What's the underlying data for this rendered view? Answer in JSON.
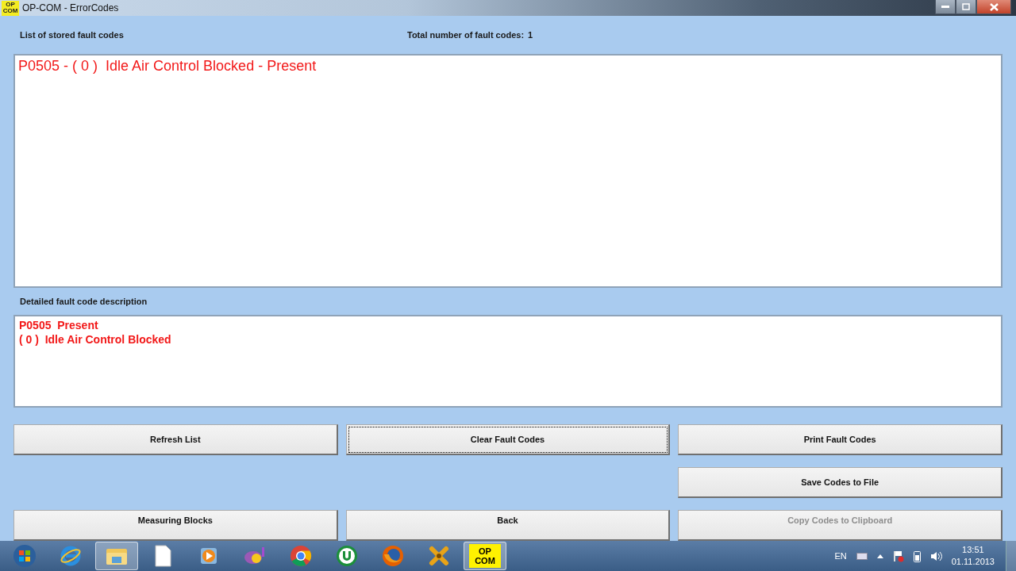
{
  "window": {
    "title": "OP-COM - ErrorCodes",
    "icon_lines": [
      "OP",
      "COM"
    ]
  },
  "list_label": "List of stored fault codes",
  "total_label": "Total number of fault codes:",
  "total_value": "1",
  "fault_list": [
    "P0505 - ( 0 )  Idle Air Control Blocked - Present"
  ],
  "detail_label": "Detailed fault code description",
  "detail_lines": [
    "P0505  Present",
    "( 0 )  Idle Air Control Blocked"
  ],
  "button_rows": [
    [
      {
        "kind": "button",
        "label": "Refresh List",
        "focused": false,
        "disabled": false
      },
      {
        "kind": "button",
        "label": "Clear Fault Codes",
        "focused": true,
        "disabled": false
      },
      {
        "kind": "button",
        "label": "Print Fault Codes",
        "focused": false,
        "disabled": false
      }
    ],
    [
      {
        "kind": "spacer"
      },
      {
        "kind": "spacer"
      },
      {
        "kind": "button",
        "label": "Save Codes to File",
        "focused": false,
        "disabled": false
      }
    ],
    [
      {
        "kind": "button",
        "label": "Measuring Blocks",
        "focused": false,
        "disabled": false
      },
      {
        "kind": "button",
        "label": "Back",
        "focused": false,
        "disabled": false
      },
      {
        "kind": "button",
        "label": "Copy Codes to Clipboard",
        "focused": false,
        "disabled": true
      }
    ]
  ],
  "taskbar": {
    "items": [
      {
        "kind": "start",
        "selected": false
      },
      {
        "kind": "browser-e",
        "selected": false
      },
      {
        "kind": "folder",
        "selected": true
      },
      {
        "kind": "document",
        "selected": false
      },
      {
        "kind": "media",
        "selected": false
      },
      {
        "kind": "messenger",
        "selected": false
      },
      {
        "kind": "chrome",
        "selected": false
      },
      {
        "kind": "torrent",
        "selected": false
      },
      {
        "kind": "firefox",
        "selected": false
      },
      {
        "kind": "tool",
        "selected": false
      },
      {
        "kind": "opcom",
        "selected": true,
        "lines": [
          "OP",
          "COM"
        ]
      }
    ],
    "language": "EN",
    "time": "13:51",
    "date": "01.11.2013"
  }
}
